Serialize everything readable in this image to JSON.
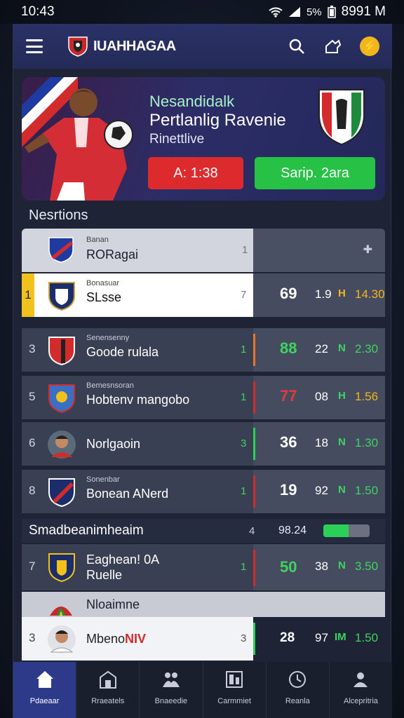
{
  "status_bar": {
    "time": "10:43",
    "battery": "5%",
    "right_text": "8991 M"
  },
  "header": {
    "brand": "IUAHHAGAA"
  },
  "hero": {
    "kicker": "Nesandidalk",
    "title": "Pertlanlig Ravenie",
    "subtitle": "Rinettlive",
    "red_button": "A: 1:38",
    "green_button": "Sarip. 2ara"
  },
  "section": {
    "title": "Nesrtions"
  },
  "table_header": {
    "small": "Banan",
    "name": "RORagai",
    "num": "1"
  },
  "rows": [
    {
      "rank": "1",
      "small": "Bonasuar",
      "name": "SLsse",
      "count": "7",
      "points": "69",
      "played": "1.9",
      "tag": "H",
      "odds": "14.30",
      "bar": "#3a4054",
      "pts_color": "#ffffff",
      "odd_color": "#f2b61d",
      "tag_color": "#f2b61d"
    },
    {
      "rank": "3",
      "small": "Senensenny",
      "name": "Goode rulala",
      "count": "1",
      "points": "88",
      "played": "22",
      "tag": "N",
      "odds": "2.30",
      "bar": "#e8762b",
      "pts_color": "#3ed45f",
      "odd_color": "#3ed45f",
      "tag_color": "#3ed45f"
    },
    {
      "rank": "5",
      "small": "Bemesnsoran",
      "name": "Hobtenv mangobo",
      "count": "1",
      "points": "77",
      "played": "08",
      "tag": "H",
      "odds": "1.56",
      "bar": "#d32b2b",
      "pts_color": "#e43a3a",
      "odd_color": "#f2b61d",
      "tag_color": "#3ed45f"
    },
    {
      "rank": "6",
      "small": "",
      "name": "Norlgaoin",
      "count": "3",
      "points": "36",
      "played": "18",
      "tag": "N",
      "odds": "1.30",
      "bar": "#2bd157",
      "pts_color": "#ffffff",
      "odd_color": "#3ed45f",
      "tag_color": "#3ed45f"
    },
    {
      "rank": "8",
      "small": "Sonenbar",
      "name": "Bonean ANerd",
      "count": "1",
      "points": "19",
      "played": "92",
      "tag": "N",
      "odds": "1.50",
      "bar": "#d32b2b",
      "pts_color": "#ffffff",
      "odd_color": "#3ed45f",
      "tag_color": "#3ed45f"
    }
  ],
  "strip": {
    "label": "Smadbeanimheaim",
    "num": "4",
    "time": "98.24",
    "progress": 0.55
  },
  "row_extra": {
    "rank": "7",
    "name_line1": "Eaghean! 0A",
    "name_line2": "Ruelle",
    "count": "1",
    "points": "50",
    "played": "38",
    "tag": "N",
    "odds": "3.50"
  },
  "group": {
    "label": "Nloaimne"
  },
  "row_last": {
    "rank": "3",
    "name": "Mbeno",
    "name_tag": "NIV",
    "count": "3",
    "points": "28",
    "played": "97",
    "tag": "IM",
    "odds": "1.50"
  },
  "nav": [
    {
      "label": "Pdaeaar",
      "icon": "home-icon"
    },
    {
      "label": "Rraeatels",
      "icon": "building-icon"
    },
    {
      "label": "Bnaeedie",
      "icon": "people-icon"
    },
    {
      "label": "Carmmiet",
      "icon": "board-icon"
    },
    {
      "label": "Reanla",
      "icon": "clock-icon"
    },
    {
      "label": "Alcepritria",
      "icon": "profile-icon"
    }
  ],
  "colors": {
    "accent_green": "#27c146",
    "accent_red": "#dd2a2c",
    "header_bg": "#2a3166",
    "highlight": "#f2c21c"
  }
}
